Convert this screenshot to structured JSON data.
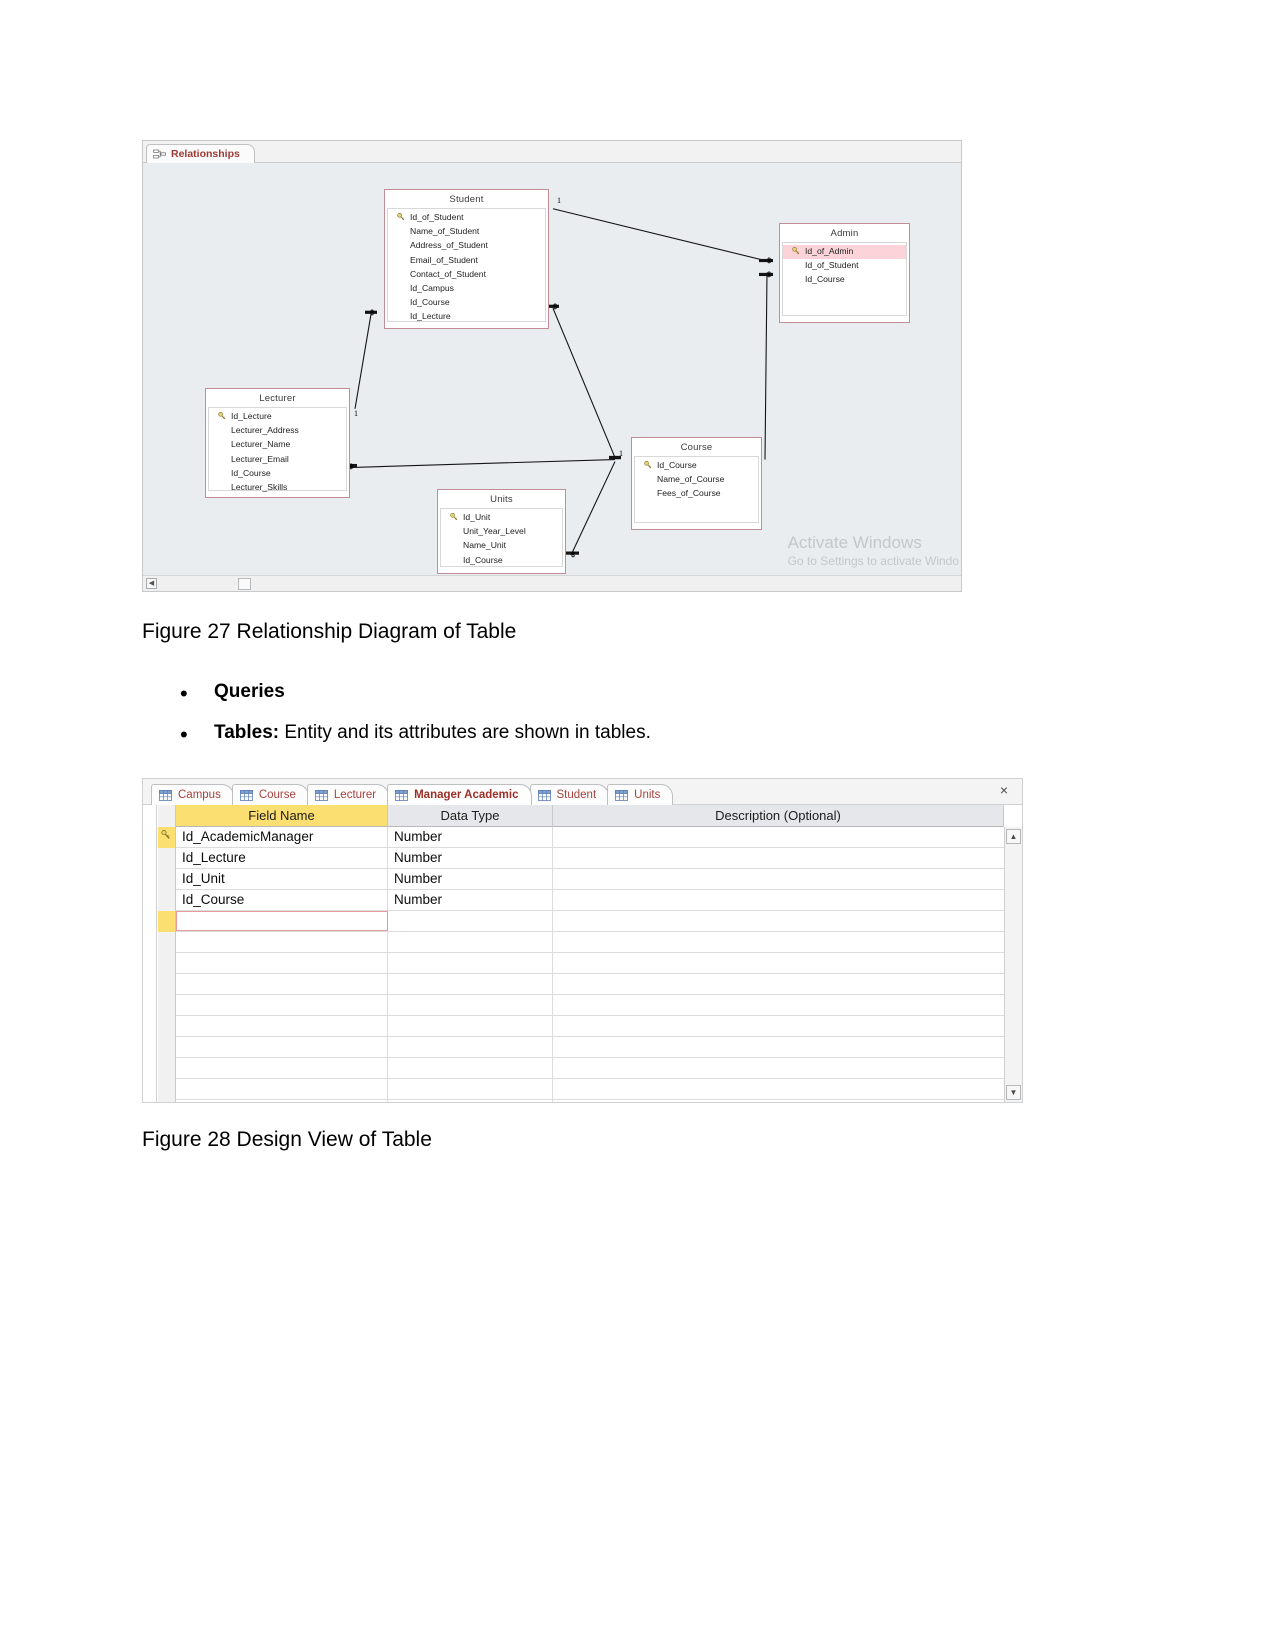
{
  "figure27": {
    "caption": "Figure 27 Relationship Diagram of Table",
    "window": {
      "tab_label": "Relationships",
      "watermark_line1": "Activate Windows",
      "watermark_line2": "Go to Settings to activate Windo"
    },
    "tables": [
      {
        "name": "Student",
        "fields": [
          "Id_of_Student",
          "Name_of_Student",
          "Address_of_Student",
          "Email_of_Student",
          "Contact_of_Student",
          "Id_Campus",
          "Id_Course",
          "Id_Lecture"
        ],
        "primary_key": "Id_of_Student"
      },
      {
        "name": "Admin",
        "fields": [
          "Id_of_Admin",
          "Id_of_Student",
          "Id_Course"
        ],
        "primary_key": "Id_of_Admin",
        "selected_field": "Id_of_Admin"
      },
      {
        "name": "Lecturer",
        "fields": [
          "Id_Lecture",
          "Lecturer_Address",
          "Lecturer_Name",
          "Lecturer_Email",
          "Id_Course",
          "Lecturer_Skills"
        ],
        "primary_key": "Id_Lecture"
      },
      {
        "name": "Units",
        "fields": [
          "Id_Unit",
          "Unit_Year_Level",
          "Name_Unit",
          "Id_Course"
        ],
        "primary_key": "Id_Unit"
      },
      {
        "name": "Course",
        "fields": [
          "Id_Course",
          "Name_of_Course",
          "Fees_of_Course"
        ],
        "primary_key": "Id_Course"
      }
    ],
    "cardinality_labels": {
      "one": "1",
      "many": "∞"
    }
  },
  "bullets": {
    "queries": "Queries",
    "tables_bold": "Tables:",
    "tables_rest": " Entity and its attributes are shown in tables."
  },
  "figure28": {
    "caption": "Figure 28 Design View of Table",
    "close_label": "×",
    "tabs": [
      {
        "label": "Campus",
        "active": false
      },
      {
        "label": "Course",
        "active": false
      },
      {
        "label": "Lecturer",
        "active": false
      },
      {
        "label": "Manager Academic",
        "active": true
      },
      {
        "label": "Student",
        "active": false
      },
      {
        "label": "Units",
        "active": false
      }
    ],
    "columns": [
      "Field Name",
      "Data Type",
      "Description (Optional)"
    ],
    "rows": [
      {
        "field": "Id_AcademicManager",
        "type": "Number",
        "description": "",
        "primary_key": true
      },
      {
        "field": "Id_Lecture",
        "type": "Number",
        "description": "",
        "primary_key": false
      },
      {
        "field": "Id_Unit",
        "type": "Number",
        "description": "",
        "primary_key": false
      },
      {
        "field": "Id_Course",
        "type": "Number",
        "description": "",
        "primary_key": false
      },
      {
        "field": "",
        "type": "",
        "description": "",
        "primary_key": false,
        "new_row": true
      }
    ],
    "scroll_up": "▲",
    "scroll_down": "▼"
  }
}
